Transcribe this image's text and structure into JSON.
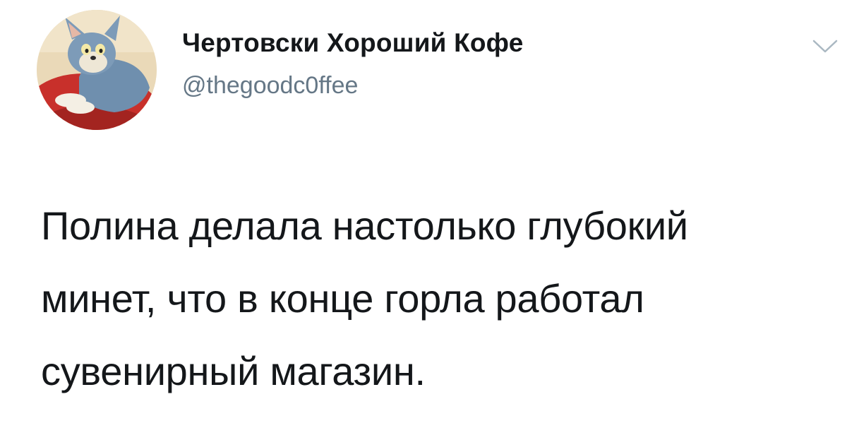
{
  "tweet": {
    "author": {
      "display_name": "Чертовски Хороший Кофе",
      "handle": "@thegoodc0ffee",
      "avatar_icon": "cartoon-cat-avatar"
    },
    "menu_icon": "chevron-down-icon",
    "text": "Полина делала настолько глубокий\nминет, что в конце горла работал\nсувенирный магазин."
  },
  "colors": {
    "text": "#14171a",
    "secondary_text": "#657786",
    "chevron": "#aab8c2"
  }
}
